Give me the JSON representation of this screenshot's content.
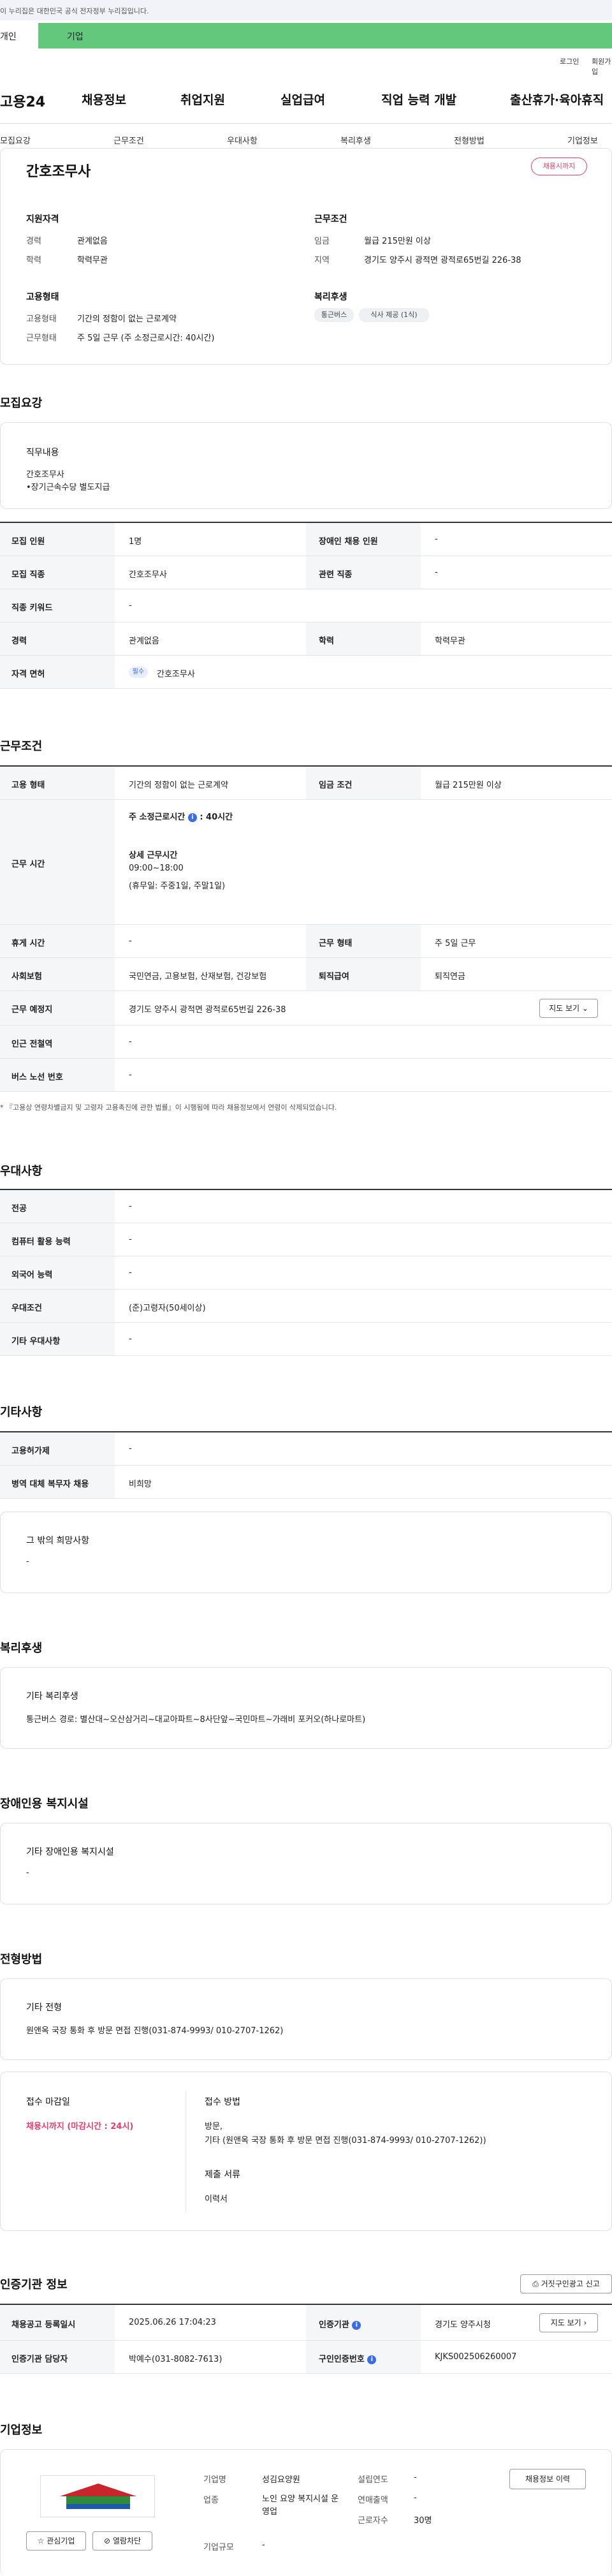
{
  "gov_banner": "이 누리집은 대한민국 공식 전자정부 누리집입니다.",
  "top_tabs": [
    "개인",
    "기업"
  ],
  "util": {
    "login": "로그인",
    "join": "회원가입"
  },
  "gnb": {
    "logo": "고용24",
    "items": [
      "채용정보",
      "취업지원",
      "실업급여",
      "직업 능력 개발",
      "출산휴가·육아휴직"
    ]
  },
  "subnav": [
    "모집요강",
    "근무조건",
    "우대사항",
    "복리후생",
    "전형방법",
    "기업정보"
  ],
  "header_card": {
    "title": "간호조무사",
    "status_badge": "채용시까지",
    "qual": {
      "title": "지원자격",
      "rows": [
        [
          "경력",
          "관계없음"
        ],
        [
          "학력",
          "학력무관"
        ]
      ]
    },
    "cond": {
      "title": "근무조건",
      "rows": [
        [
          "임금",
          "월급 215만원 이상"
        ],
        [
          "지역",
          "경기도 양주시 광적면 광적로65번길 226-38"
        ]
      ]
    },
    "emp": {
      "title": "고용형태",
      "rows": [
        [
          "고용형태",
          "기간의 정함이 없는 근로계약"
        ],
        [
          "근무형태",
          "주 5일 근무 (주 소정근로시간: 40시간)"
        ]
      ]
    },
    "benefit": {
      "title": "복리후생",
      "chips": [
        "통근버스",
        "식사 제공 (1식)"
      ]
    }
  },
  "recruit": {
    "title": "모집요강",
    "duty_title": "직무내용",
    "duty_lines": [
      "간호조무사",
      "•장기근속수당 별도지급"
    ],
    "rows": [
      {
        "l1": "모집 인원",
        "v1": "1명",
        "l2": "장애인 채용 인원",
        "v2": "-"
      },
      {
        "l1": "모집 직종",
        "v1": "간호조무사",
        "l2": "관련 직종",
        "v2": "-"
      },
      {
        "l1": "직종 키워드",
        "v1": "-"
      },
      {
        "l1": "경력",
        "v1": "관계없음",
        "l2": "학력",
        "v2": "학력무관"
      },
      {
        "l1": "자격 면허",
        "tag": "필수",
        "v1": "간호조무사"
      }
    ]
  },
  "work": {
    "title": "근무조건",
    "employ": {
      "l1": "고용 형태",
      "v1": "기간의 정함이 없는 근로계약",
      "l2": "임금 조건",
      "v2": "월급 215만원 이상"
    },
    "hours": {
      "label": "근무 시간",
      "weekly": "주 소정근로시간",
      "weekly_val": ": 40시간",
      "detail_title": "상세 근무시간",
      "detail_time": "09:00~18:00",
      "detail_rest": "(휴무일: 주중1일, 주말1일)"
    },
    "rows": [
      {
        "l1": "휴게 시간",
        "v1": "-",
        "l2": "근무 형태",
        "v2": "주 5일 근무"
      },
      {
        "l1": "사회보험",
        "v1": "국민연금, 고용보험, 산재보험, 건강보험",
        "l2": "퇴직급여",
        "v2": "퇴직연금"
      }
    ],
    "location": {
      "label": "근무 예정지",
      "value": "경기도 양주시 광적면 광적로65번길 226-38",
      "map_btn": "지도 보기"
    },
    "rows2": [
      {
        "l1": "인근 전철역",
        "v1": "-"
      },
      {
        "l1": "버스 노선 번호",
        "v1": "-"
      }
    ],
    "note": "* 『고용상 연령차별금지 및 고령자 고용촉진에 관한 법률』이 시행됨에 따라 채용정보에서 연령이 삭제되었습니다."
  },
  "pref": {
    "title": "우대사항",
    "rows": [
      [
        "전공",
        "-"
      ],
      [
        "컴퓨터 활용 능력",
        "-"
      ],
      [
        "외국어 능력",
        "-"
      ],
      [
        "우대조건",
        "(준)고령자(50세이상)"
      ],
      [
        "기타 우대사항",
        "-"
      ]
    ]
  },
  "etc": {
    "title": "기타사항",
    "rows": [
      [
        "고용허가제",
        "-"
      ],
      [
        "병역 대체 복무자 채용",
        "비희망"
      ]
    ],
    "hope_title": "그 밖의 희망사항",
    "hope_val": "-"
  },
  "welfare": {
    "title": "복리후생",
    "sub": "기타 복리후생",
    "text": "통근버스 경로: 별산대~오산삼거리~대교아파트~8사단앞~국민마트~가래비 포커오(하나로마트)"
  },
  "disab": {
    "title": "장애인용 복지시설",
    "sub": "기타 장애인용 복지시설",
    "val": "-"
  },
  "selection": {
    "title": "전형방법",
    "sub": "기타 전형",
    "text": "원앤옥 국장 통화 후 방문 면접 진행(031-874-9993/ 010-2707-1262)",
    "deadline_title": "접수 마감일",
    "deadline_val": "채용시까지 (마감시간 : 24시)",
    "method_title": "접수 방법",
    "method_l1": "방문,",
    "method_l2": "기타 (원앤옥 국장 통화 후 방문 면접 진행(031-874-9993/ 010-2707-1262))",
    "docs_title": "제출 서류",
    "docs_val": "이력서"
  },
  "agency": {
    "title": "인증기관 정보",
    "report_btn": "거짓구인광고 신고",
    "r1": {
      "l1": "채용공고 등록일시",
      "v1": "2025.06.26 17:04:23",
      "l2": "인증기관",
      "v2": "경기도 양주시청",
      "btn": "지도 보기"
    },
    "r2": {
      "l1": "인증기관 담당자",
      "v1": "박예수(031-8082-7613)",
      "l2": "구인인증번호",
      "v2": "KJKS002506260007"
    }
  },
  "company": {
    "title": "기업정보",
    "fav_btn": "관심기업",
    "block_btn": "열람차단",
    "history_btn": "채용정보 이력",
    "rows": [
      [
        "기업명",
        "성김요양원",
        "설립연도",
        "-"
      ],
      [
        "업종",
        "노인 요양 복지시설 운영업",
        "연매출액",
        "-"
      ],
      [
        "",
        "",
        "근로자수",
        "30명"
      ],
      [
        "기업규모",
        "-",
        "",
        ""
      ]
    ]
  }
}
